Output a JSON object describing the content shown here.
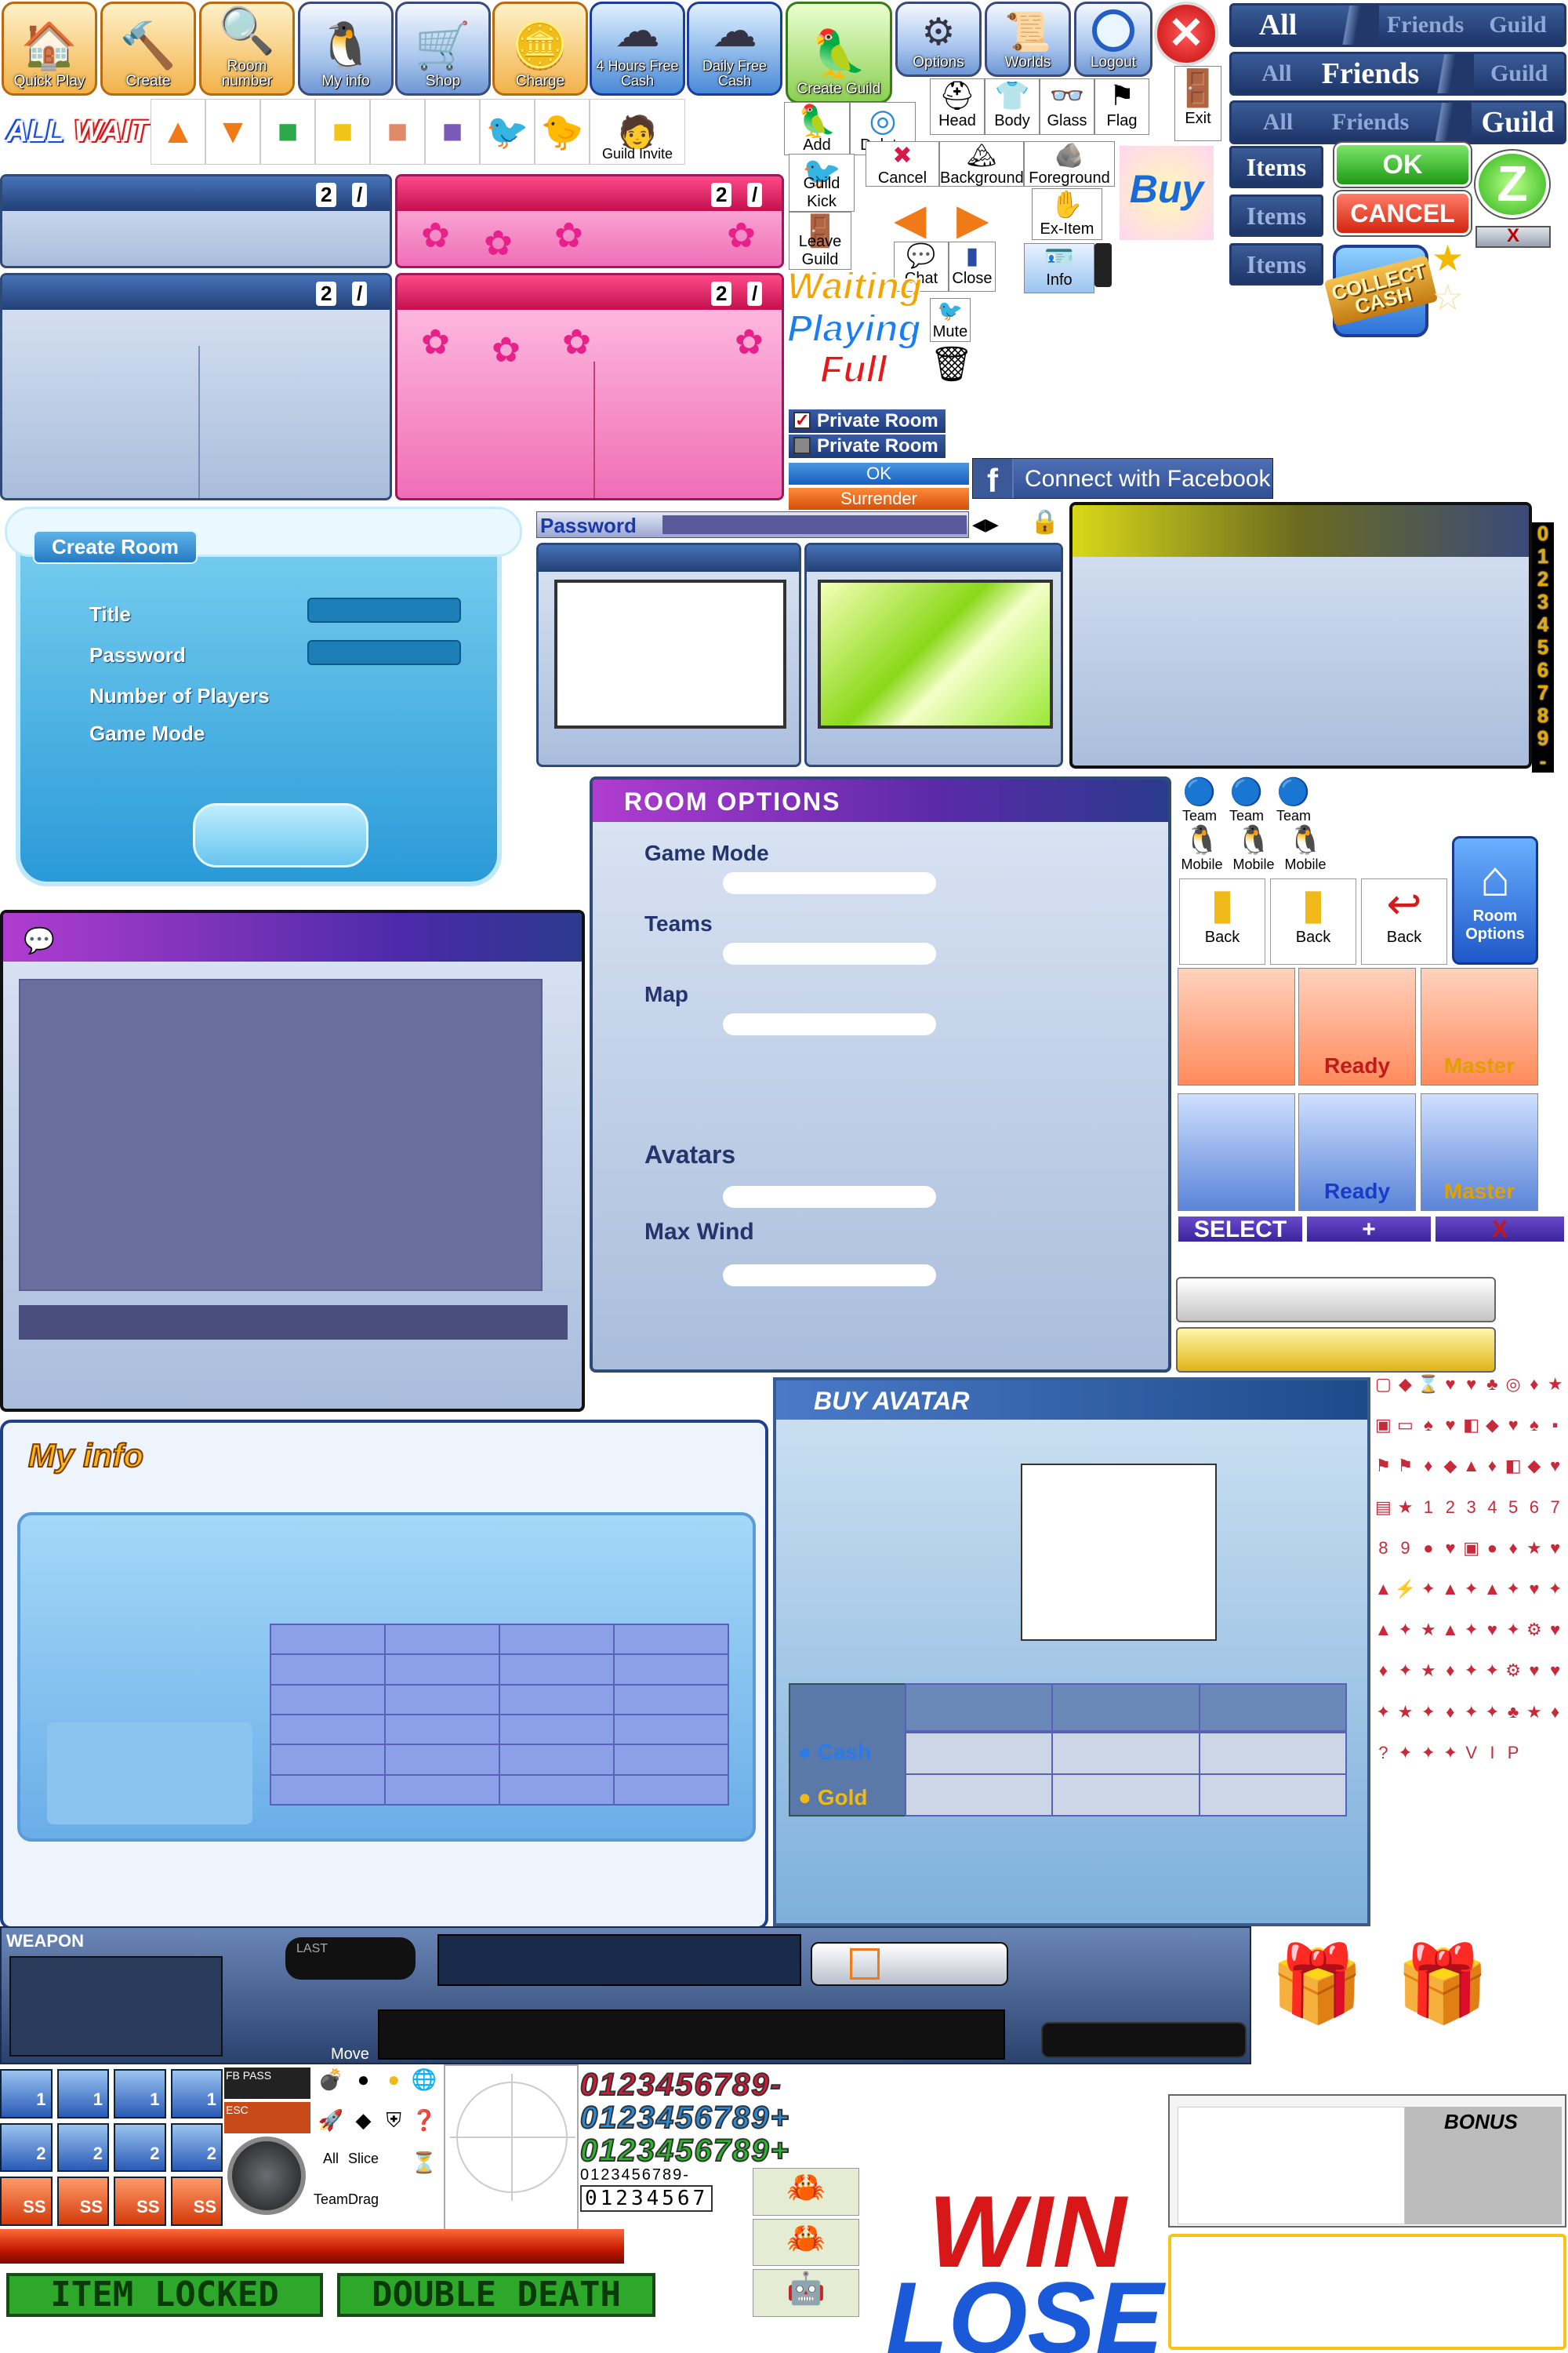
{
  "toolbar": {
    "buttons": [
      {
        "label": "Quick Play",
        "icon": "house-icon"
      },
      {
        "label": "Create",
        "icon": "hammer-icon"
      },
      {
        "label": "Room number",
        "icon": "magnifier-icon"
      },
      {
        "label": "My info",
        "icon": "penguin-icon"
      },
      {
        "label": "Shop",
        "icon": "cart-icon"
      },
      {
        "label": "Charge",
        "icon": "coins-icon"
      },
      {
        "label": "4 Hours Free Cash",
        "icon": "cloud-icon"
      },
      {
        "label": "Daily Free Cash",
        "icon": "cloud-icon"
      },
      {
        "label": "Create Guild",
        "icon": "guild-icon"
      },
      {
        "label": "Options",
        "icon": "gear-icon"
      },
      {
        "label": "Worlds",
        "icon": "scroll-icon"
      },
      {
        "label": "Logout",
        "icon": "power-icon"
      }
    ],
    "close": "✕"
  },
  "tabs": [
    {
      "items": [
        "All",
        "Friends",
        "Guild"
      ],
      "active": 0
    },
    {
      "items": [
        "All",
        "Friends",
        "Guild"
      ],
      "active": 1
    },
    {
      "items": [
        "All",
        "Friends",
        "Guild"
      ],
      "active": 2
    }
  ],
  "items_tabs": [
    "Items",
    "Items",
    "Items"
  ],
  "buttons": {
    "ok": "OK",
    "cancel": "CANCEL",
    "z": "Z",
    "x": "X",
    "collect_cash": "COLLECT CASH",
    "buy": "Buy"
  },
  "filter": {
    "all": "ALL",
    "wait": "WAIT"
  },
  "small_labels": {
    "guild_invite": "Guild Invite",
    "add": "Add",
    "delete": "Delete",
    "head": "Head",
    "body": "Body",
    "glass": "Glass",
    "flag": "Flag",
    "exit": "Exit",
    "guild_kick": "Guild Kick",
    "cancel": "Cancel",
    "background": "Background",
    "foreground": "Foreground",
    "ex_item": "Ex-Item",
    "leave_guild": "Leave Guild",
    "chat": "Chat",
    "close": "Close",
    "info": "Info",
    "mute": "Mute"
  },
  "room_status": {
    "waiting": "Waiting",
    "playing": "Playing",
    "full": "Full"
  },
  "room_header_nums": [
    "2",
    "/",
    "2",
    "/",
    "2",
    "/",
    "2",
    "/"
  ],
  "private_room": [
    "Private Room",
    "Private Room"
  ],
  "ok_bar": "OK",
  "surrender": "Surrender",
  "facebook": {
    "label": "Connect with Facebook",
    "glyph": "f"
  },
  "password_label": "Password",
  "create_room": {
    "title": "Create Room",
    "fields": [
      "Title",
      "Password",
      "Number of Players",
      "Game Mode"
    ]
  },
  "room_options": {
    "title": "ROOM OPTIONS",
    "fields": [
      "Game Mode",
      "Teams",
      "Map",
      "Avatars",
      "Max Wind"
    ],
    "button": "Room Options"
  },
  "digits": [
    "0",
    "1",
    "2",
    "3",
    "4",
    "5",
    "6",
    "7",
    "8",
    "9",
    "-"
  ],
  "team_labels": [
    "Team",
    "Team",
    "Team"
  ],
  "mobile_labels": [
    "Mobile",
    "Mobile",
    "Mobile"
  ],
  "back_labels": [
    "Back",
    "Back",
    "Back"
  ],
  "chevrons": {
    "top": [
      "",
      "Ready",
      "Master"
    ],
    "bottom": [
      "",
      "Ready",
      "Master"
    ]
  },
  "select_bar": [
    "SELECT",
    "+",
    "X"
  ],
  "my_info": {
    "title": "My info"
  },
  "buy_avatar": {
    "title": "BUY AVATAR",
    "cash": "Cash",
    "gold": "Gold"
  },
  "hud": {
    "weapon": "WEAPON",
    "last": "LAST",
    "move": "Move"
  },
  "small_tool": {
    "fb_pass": "FB PASS",
    "esc": "ESC",
    "all": "All",
    "team": "Team",
    "slice": "Slice",
    "drag": "Drag",
    "ss": "SS",
    "1": "1",
    "2": "2"
  },
  "num_rows": [
    "0123456789-",
    "0123456789+",
    "0123456789+"
  ],
  "small_digits": "0123456789-",
  "lcd_digits": "01234567",
  "locks": [
    "ITEM LOCKED",
    "DOUBLE DEATH"
  ],
  "bonus": "BONUS",
  "result": {
    "win": "WIN",
    "lose": "LOSE"
  },
  "colors": {
    "accent": "#2d4a78",
    "pink": "#f06eb6",
    "ok": "#1e9a14",
    "cancel": "#d2250e",
    "waiting": "#f4a400",
    "playing": "#1b7ef0",
    "full": "#e81818"
  }
}
